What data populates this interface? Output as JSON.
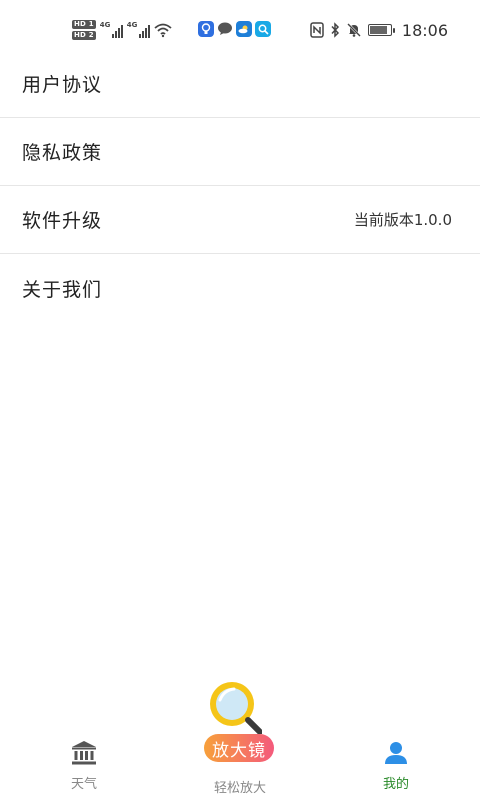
{
  "status_bar": {
    "hd1": "HD 1",
    "hd2": "HD 2",
    "net1": "4G",
    "net2": "4G",
    "time": "18:06",
    "icons": [
      "wifi-icon",
      "bulb-app-icon",
      "message-app-icon",
      "weather-app-icon",
      "search-app-icon",
      "nfc-icon",
      "bluetooth-icon",
      "mute-icon",
      "battery-icon"
    ]
  },
  "menu": {
    "items": [
      {
        "label": "用户协议",
        "value": ""
      },
      {
        "label": "隐私政策",
        "value": ""
      },
      {
        "label": "软件升级",
        "value": "当前版本1.0.0"
      },
      {
        "label": "关于我们",
        "value": ""
      }
    ]
  },
  "bottom_nav": {
    "tabs": [
      {
        "label": "天气",
        "icon": "bank-icon",
        "active": false
      },
      {
        "label": "轻松放大",
        "badge": "放大镜",
        "icon": "magnifier-icon",
        "active": false
      },
      {
        "label": "我的",
        "icon": "user-icon",
        "active": true
      }
    ]
  },
  "colors": {
    "active_tab": "#2a8a2a",
    "inactive_tab": "#888888",
    "badge_gradient_start": "#f7a03a",
    "badge_gradient_end": "#f45a7c",
    "magnifier_ring": "#f5c518",
    "user_icon": "#2d8fe6"
  }
}
